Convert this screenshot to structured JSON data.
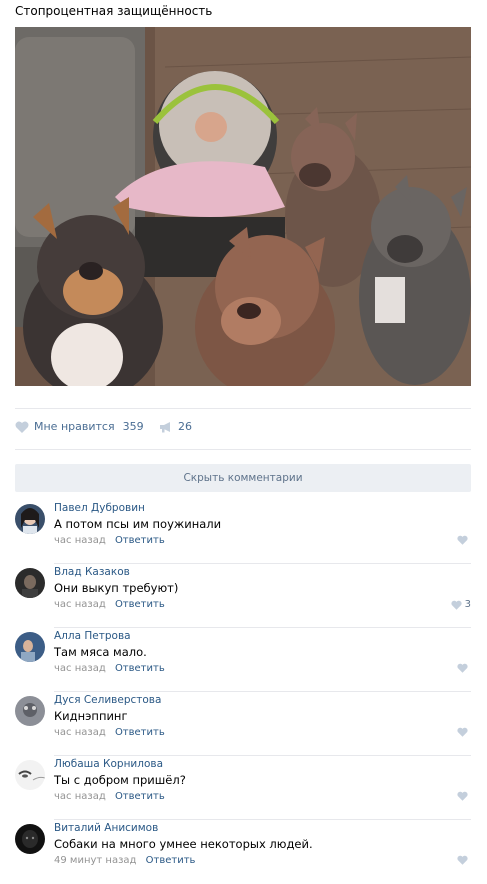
{
  "post": {
    "text": "Стопроцентная защищённость"
  },
  "actions": {
    "like_label": "Мне нравится",
    "like_count": "359",
    "share_count": "26"
  },
  "hide_comments_label": "Скрыть комментарии",
  "comments": [
    {
      "author": "Павел Дубровин",
      "text": "А потом псы им поужинали",
      "time": "час назад",
      "reply": "Ответить",
      "likes": ""
    },
    {
      "author": "Влад Казаков",
      "text": "Они выкуп требуют)",
      "time": "час назад",
      "reply": "Ответить",
      "likes": "3"
    },
    {
      "author": "Алла Петрова",
      "text": "Там мяса мало.",
      "time": "час назад",
      "reply": "Ответить",
      "likes": ""
    },
    {
      "author": "Дуся Селиверстова",
      "text": "Киднэппинг",
      "time": "час назад",
      "reply": "Ответить",
      "likes": ""
    },
    {
      "author": "Любаша Корнилова",
      "text": "Ты с добром пришёл?",
      "time": "час назад",
      "reply": "Ответить",
      "likes": ""
    },
    {
      "author": "Виталий Анисимов",
      "text": "Собаки на много умнее некоторых людей.",
      "time": "49 минут назад",
      "reply": "Ответить",
      "likes": ""
    }
  ],
  "colors": {
    "link": "#2a5885",
    "muted": "#939393",
    "icon": "#c4cfdc"
  }
}
